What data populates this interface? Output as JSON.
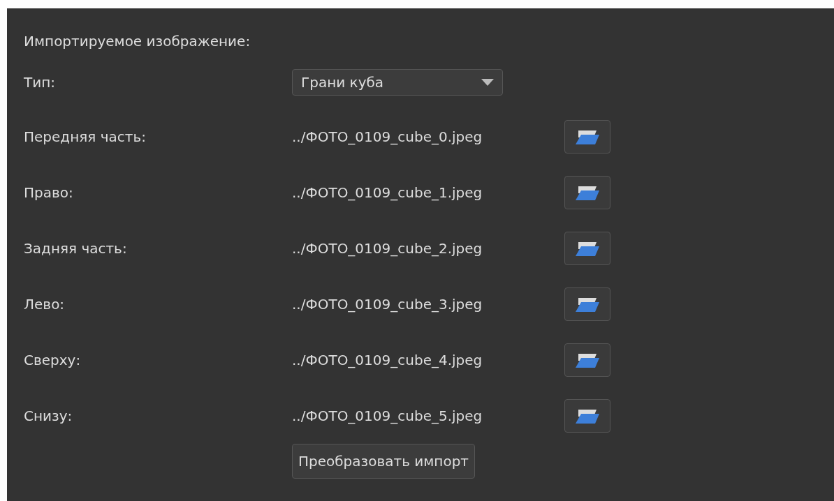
{
  "section_title": "Импортируемое изображение:",
  "type_field": {
    "label": "Тип:",
    "value": "Грани куба"
  },
  "faces": [
    {
      "label": "Передняя часть:",
      "path": "../ФОТО_0109_cube_0.jpeg"
    },
    {
      "label": "Право:",
      "path": "../ФОТО_0109_cube_1.jpeg"
    },
    {
      "label": "Задняя часть:",
      "path": "../ФОТО_0109_cube_2.jpeg"
    },
    {
      "label": "Лево:",
      "path": "../ФОТО_0109_cube_3.jpeg"
    },
    {
      "label": "Сверху:",
      "path": "../ФОТО_0109_cube_4.jpeg"
    },
    {
      "label": "Снизу:",
      "path": "../ФОТО_0109_cube_5.jpeg"
    }
  ],
  "convert_button": "Преобразовать импорт"
}
